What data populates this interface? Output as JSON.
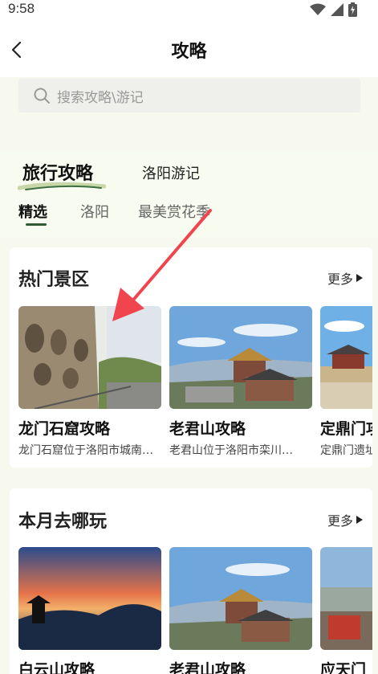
{
  "status": {
    "time": "9:58"
  },
  "header": {
    "title": "攻略"
  },
  "search": {
    "placeholder": "搜索攻略\\游记"
  },
  "main_tabs": [
    {
      "label": "旅行攻略"
    },
    {
      "label": "洛阳游记"
    }
  ],
  "sub_tabs": [
    {
      "label": "精选"
    },
    {
      "label": "洛阳"
    },
    {
      "label": "最美赏花季"
    }
  ],
  "sections": [
    {
      "title": "热门景区",
      "more": "更多",
      "cards": [
        {
          "title": "龙门石窟攻略",
          "desc": "龙门石窟位于洛阳市城南…"
        },
        {
          "title": "老君山攻略",
          "desc": "老君山位于洛阳市栾川…"
        },
        {
          "title": "定鼎门攻",
          "desc": "定鼎门遗址"
        }
      ]
    },
    {
      "title": "本月去哪玩",
      "more": "更多",
      "cards": [
        {
          "title": "白云山攻略",
          "desc": ""
        },
        {
          "title": "老君山攻略",
          "desc": ""
        },
        {
          "title": "应天门",
          "desc": ""
        }
      ]
    }
  ],
  "colors": {
    "accent": "#2f5a34",
    "annotation_arrow": "#f0444f"
  }
}
